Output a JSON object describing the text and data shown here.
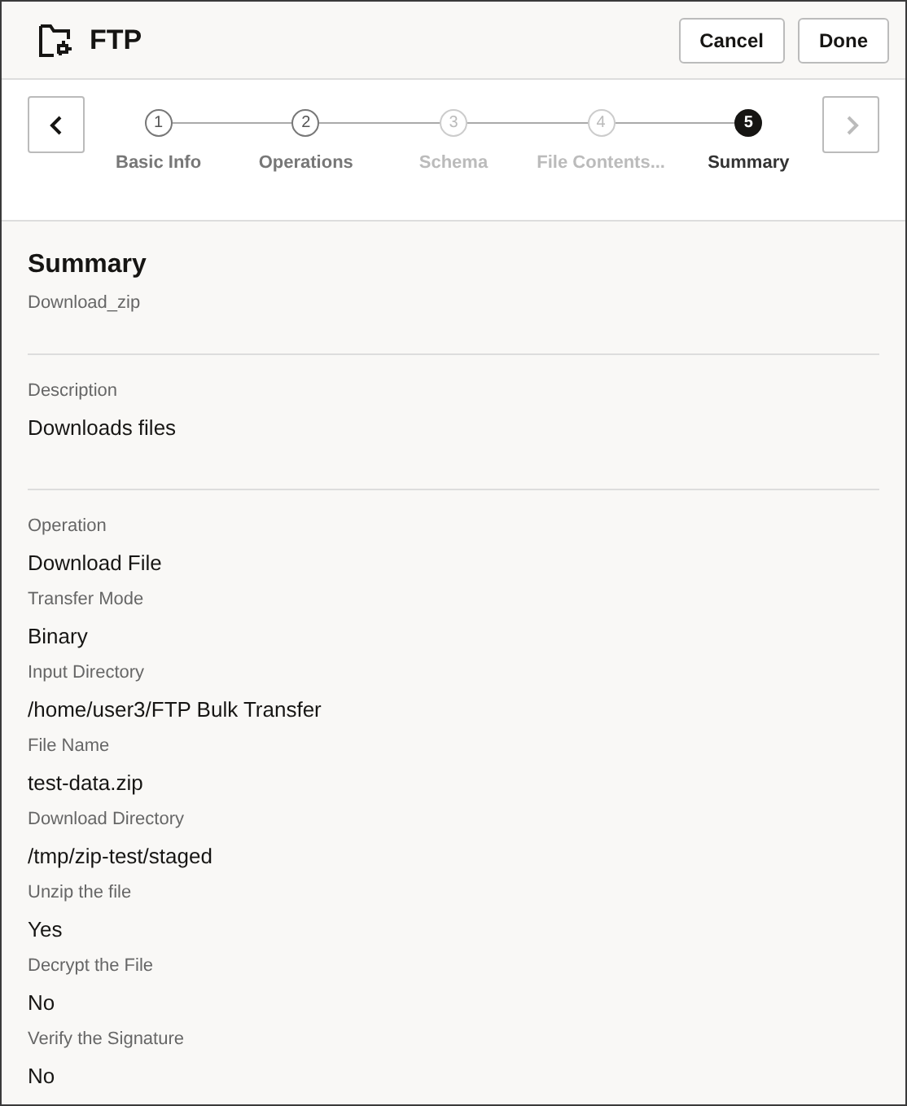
{
  "header": {
    "title": "FTP",
    "buttons": [
      {
        "label": "Cancel"
      },
      {
        "label": "Done"
      }
    ]
  },
  "stepper": {
    "prev_disabled": false,
    "next_disabled": true,
    "steps": [
      {
        "number": "1",
        "label": "Basic Info",
        "selected": false,
        "disabled": false
      },
      {
        "number": "2",
        "label": "Operations",
        "selected": false,
        "disabled": false
      },
      {
        "number": "3",
        "label": "Schema",
        "selected": false,
        "disabled": true
      },
      {
        "number": "4",
        "label": "File Contents...",
        "selected": false,
        "disabled": true
      },
      {
        "number": "5",
        "label": "Summary",
        "selected": true,
        "disabled": false
      }
    ]
  },
  "summary": {
    "title": "Summary",
    "subtitle": "Download_zip",
    "description": {
      "label": "Description",
      "value": "Downloads files"
    },
    "fields": [
      {
        "label": "Operation",
        "value": "Download File"
      },
      {
        "label": "Transfer Mode",
        "value": "Binary"
      },
      {
        "label": "Input Directory",
        "value": "/home/user3/FTP Bulk Transfer"
      },
      {
        "label": "File Name",
        "value": "test-data.zip"
      },
      {
        "label": "Download Directory",
        "value": "/tmp/zip-test/staged"
      },
      {
        "label": "Unzip the file",
        "value": "Yes"
      },
      {
        "label": "Decrypt the File",
        "value": "No"
      },
      {
        "label": "Verify the Signature",
        "value": "No"
      }
    ]
  }
}
